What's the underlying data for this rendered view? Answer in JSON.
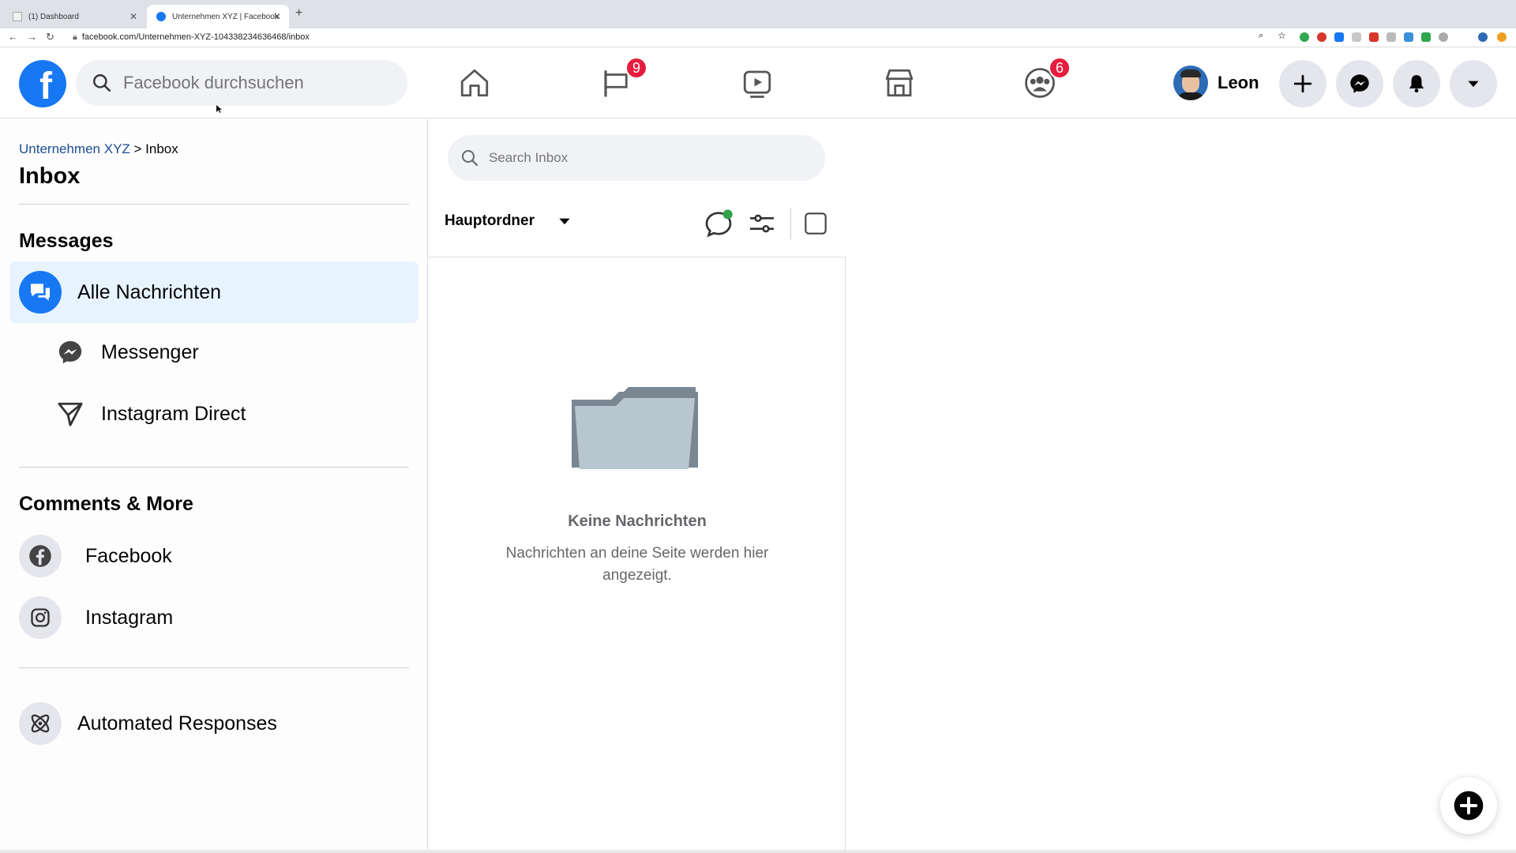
{
  "browser": {
    "tabs": [
      {
        "label": "(1) Dashboard",
        "active": false
      },
      {
        "label": "Unternehmen XYZ | Facebook",
        "active": true
      }
    ],
    "url": "facebook.com/Unternehmen-XYZ-104338234636468/inbox"
  },
  "header": {
    "logo": "f",
    "search_placeholder": "Facebook durchsuchen",
    "pages_badge": "9",
    "groups_badge": "6",
    "profile_name": "Leon"
  },
  "sidebar": {
    "breadcrumb_parent": "Unternehmen XYZ",
    "breadcrumb_sep": " > ",
    "breadcrumb_current": "Inbox",
    "title": "Inbox",
    "messages_heading": "Messages",
    "all_messages": "Alle Nachrichten",
    "messenger": "Messenger",
    "instagram_direct": "Instagram Direct",
    "comments_heading": "Comments & More",
    "facebook": "Facebook",
    "instagram": "Instagram",
    "automated": "Automated Responses"
  },
  "inbox": {
    "search_placeholder": "Search Inbox",
    "folder": "Hauptordner",
    "empty_title": "Keine Nachrichten",
    "empty_desc": "Nachrichten an deine Seite werden hier angezeigt."
  },
  "colors": {
    "brand_blue": "#1877f2",
    "badge_red": "#e41e3f",
    "selected_bg": "#e7f3ff",
    "online_green": "#31a24c"
  }
}
